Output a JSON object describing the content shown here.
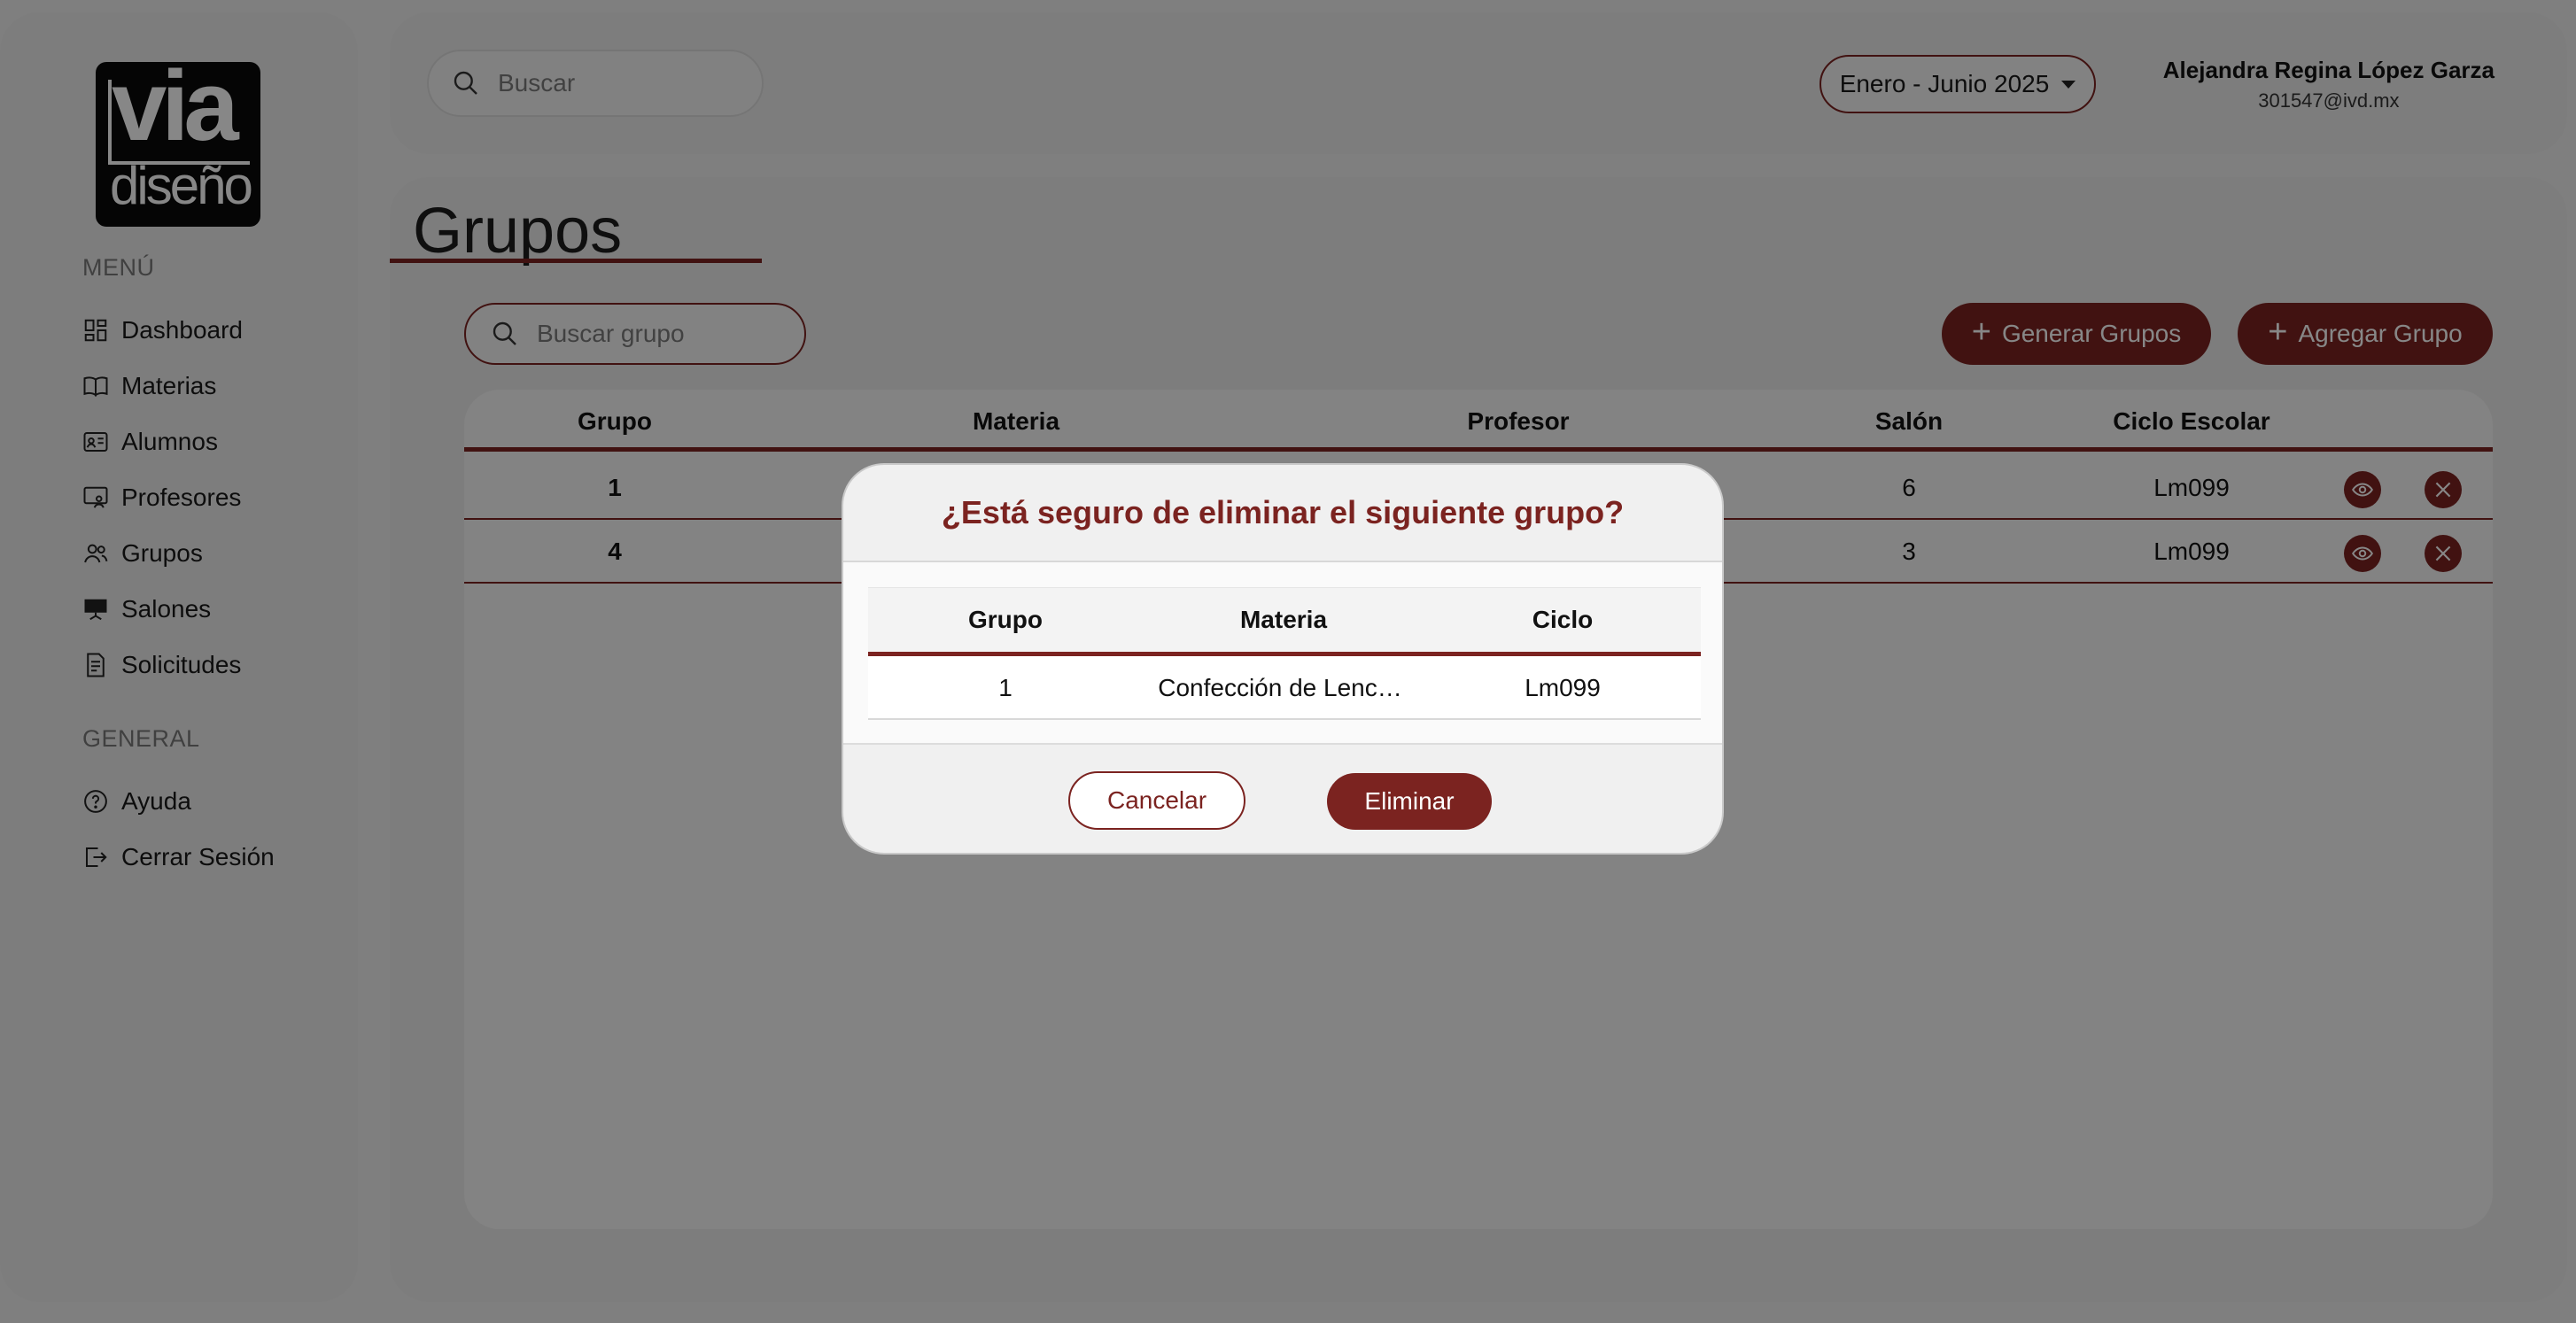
{
  "brand": {
    "logo_line1": "via",
    "logo_line2": "diseño"
  },
  "sidebar": {
    "menu_heading": "MENÚ",
    "items": [
      {
        "label": "Dashboard",
        "icon": "dashboard-icon"
      },
      {
        "label": "Materias",
        "icon": "book-icon"
      },
      {
        "label": "Alumnos",
        "icon": "id-card-icon"
      },
      {
        "label": "Profesores",
        "icon": "teacher-icon"
      },
      {
        "label": "Grupos",
        "icon": "users-icon"
      },
      {
        "label": "Salones",
        "icon": "classroom-icon"
      },
      {
        "label": "Solicitudes",
        "icon": "document-icon"
      }
    ],
    "general_heading": "GENERAL",
    "general_items": [
      {
        "label": "Ayuda",
        "icon": "help-icon"
      },
      {
        "label": "Cerrar Sesión",
        "icon": "logout-icon"
      }
    ]
  },
  "topbar": {
    "search_placeholder": "Buscar",
    "period": "Enero - Junio 2025",
    "user_name": "Alejandra Regina López Garza",
    "user_email": "301547@ivd.mx"
  },
  "main": {
    "title": "Grupos",
    "search_placeholder": "Buscar grupo",
    "generate_button": "Generar Grupos",
    "add_button": "Agregar Grupo",
    "table": {
      "headers": [
        "Grupo",
        "Materia",
        "Profesor",
        "Salón",
        "Ciclo Escolar"
      ],
      "rows": [
        {
          "grupo": "1",
          "salon": "6",
          "ciclo": "Lm099"
        },
        {
          "grupo": "4",
          "salon": "3",
          "ciclo": "Lm099"
        }
      ]
    }
  },
  "modal": {
    "title": "¿Está seguro de eliminar el siguiente grupo?",
    "headers": [
      "Grupo",
      "Materia",
      "Ciclo"
    ],
    "row": {
      "grupo": "1",
      "materia": "Confección de Lenc…",
      "ciclo": "Lm099"
    },
    "cancel_label": "Cancelar",
    "delete_label": "Eliminar"
  },
  "colors": {
    "accent": "#7b2320",
    "panel": "#ededed",
    "overlay": "rgba(0,0,0,0.47)"
  }
}
